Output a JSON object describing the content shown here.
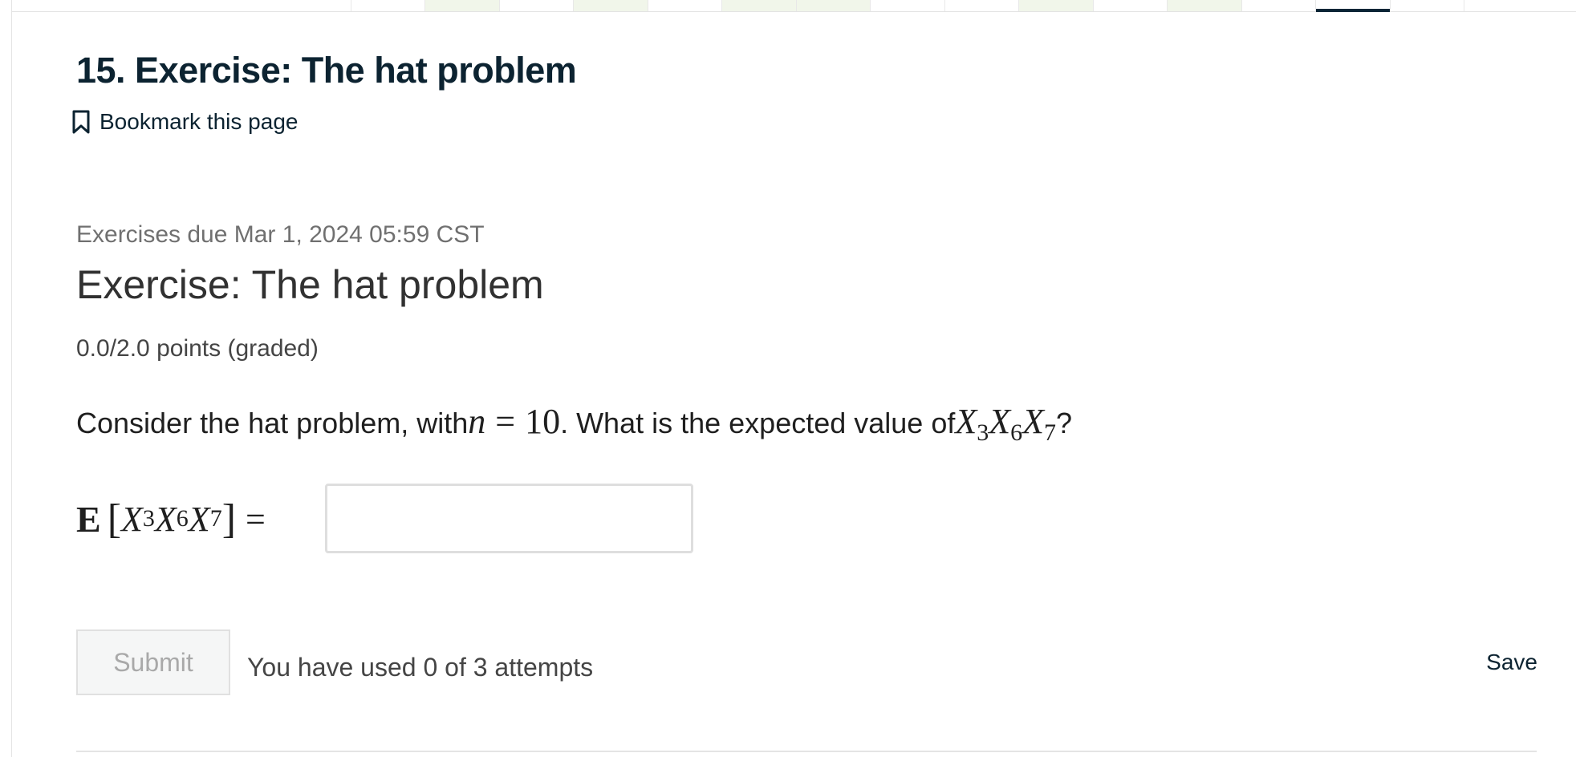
{
  "course_nav": {
    "tabs": [
      {
        "status": "default"
      },
      {
        "status": "default"
      },
      {
        "status": "completed"
      },
      {
        "status": "default"
      },
      {
        "status": "completed"
      },
      {
        "status": "default"
      },
      {
        "status": "completed"
      },
      {
        "status": "completed"
      },
      {
        "status": "default"
      },
      {
        "status": "default"
      },
      {
        "status": "completed"
      },
      {
        "status": "default"
      },
      {
        "status": "completed"
      },
      {
        "status": "default"
      },
      {
        "status": "active"
      },
      {
        "status": "default"
      }
    ]
  },
  "unit": {
    "title": "15. Exercise: The hat problem",
    "bookmark_label": "Bookmark this page",
    "bookmark_icon": "bookmark-icon"
  },
  "problem": {
    "due": "Exercises due Mar 1, 2024 05:59 CST",
    "title": "Exercise: The hat problem",
    "points": "0.0/2.0 points (graded)",
    "question": {
      "part1": "Consider the hat problem, with ",
      "n_var": "n",
      "eq": "=",
      "n_val": "10",
      "part2": ". What is the expected value of ",
      "var": "X",
      "sub_a": "3",
      "sub_b": "6",
      "sub_c": "7",
      "part3": "?"
    },
    "expression": {
      "operator": "E",
      "open_bracket": "[",
      "close_bracket": "]",
      "var": "X",
      "sub_a": "3",
      "sub_b": "6",
      "sub_c": "7",
      "eq": "="
    },
    "answer": {
      "value": "",
      "placeholder": ""
    }
  },
  "actions": {
    "submit_label": "Submit",
    "attempts_text": "You have used 0 of 3 attempts",
    "save_label": "Save"
  },
  "colors": {
    "brand_dark": "#0c2331",
    "completed_tab": "#f1f6ea",
    "active_tab_indicator": "#0a2536"
  }
}
